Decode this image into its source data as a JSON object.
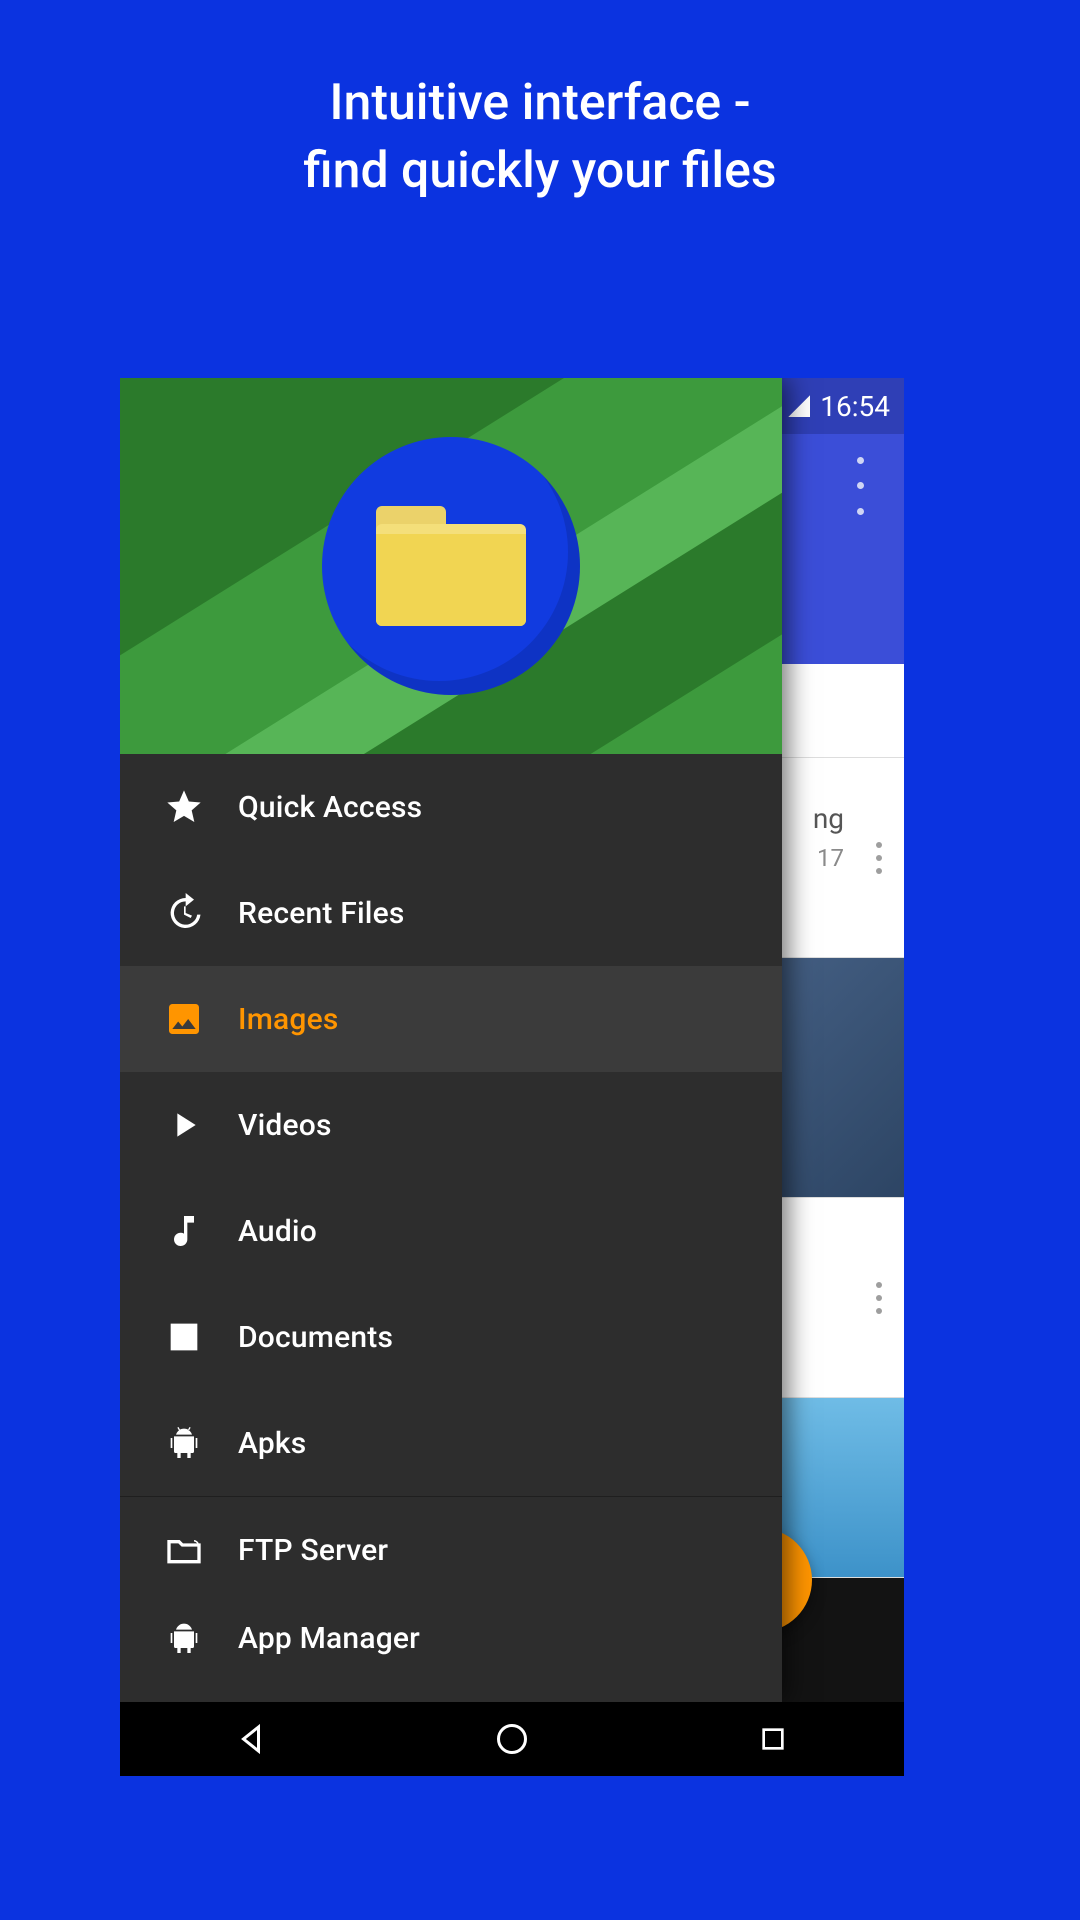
{
  "headline": {
    "line1": "Intuitive interface -",
    "line2": "find quickly your files"
  },
  "statusbar": {
    "time": "16:54"
  },
  "background_app": {
    "visible_item_label": "ng",
    "visible_item_date_fragment": "17"
  },
  "drawer": {
    "items": [
      {
        "label": "Quick Access",
        "icon": "star-icon",
        "active": false
      },
      {
        "label": "Recent Files",
        "icon": "history-icon",
        "active": false
      },
      {
        "label": "Images",
        "icon": "image-icon",
        "active": true
      },
      {
        "label": "Videos",
        "icon": "play-icon",
        "active": false
      },
      {
        "label": "Audio",
        "icon": "music-note-icon",
        "active": false
      },
      {
        "label": "Documents",
        "icon": "document-icon",
        "active": false
      },
      {
        "label": "Apks",
        "icon": "android-icon",
        "active": false
      }
    ],
    "group2": [
      {
        "label": "FTP Server",
        "icon": "folder-share-icon",
        "active": false
      },
      {
        "label": "App Manager",
        "icon": "android-icon",
        "active": false
      }
    ]
  },
  "colors": {
    "promo_bg": "#0b33e0",
    "accent": "#ff9500",
    "drawer_bg": "#2d2d2d",
    "fab": "#ff9500"
  }
}
